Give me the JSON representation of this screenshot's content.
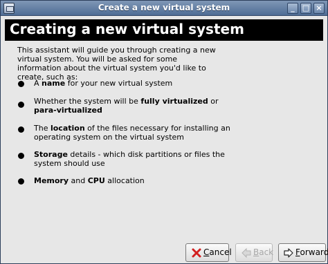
{
  "window": {
    "title": "Create a new virtual system",
    "controls": {
      "minimize": "_",
      "maximize": "□",
      "close": "×"
    }
  },
  "header": {
    "title": "Creating a new virtual system"
  },
  "intro": "This assistant will guide you through creating a new virtual system. You will be asked for some information about the virtual system you'd like to create, such as:",
  "bullets": [
    {
      "parts": [
        {
          "t": "A "
        },
        {
          "t": "name",
          "b": true
        },
        {
          "t": " for your new virtual system"
        }
      ]
    },
    {
      "parts": [
        {
          "t": "Whether the system will be "
        },
        {
          "t": "fully virtualized",
          "b": true
        },
        {
          "t": " or "
        },
        {
          "t": "para-virtualized",
          "b": true
        }
      ]
    },
    {
      "parts": [
        {
          "t": "The "
        },
        {
          "t": "location",
          "b": true
        },
        {
          "t": " of the files necessary for installing an operating system on the virtual system"
        }
      ]
    },
    {
      "parts": [
        {
          "t": "Storage",
          "b": true
        },
        {
          "t": " details - which disk partitions or files the system should use"
        }
      ]
    },
    {
      "parts": [
        {
          "t": "Memory",
          "b": true
        },
        {
          "t": " and "
        },
        {
          "t": "CPU",
          "b": true
        },
        {
          "t": " allocation"
        }
      ]
    }
  ],
  "buttons": {
    "cancel": {
      "mnemonic": "C",
      "rest": "ancel",
      "icon": "cancel-x-icon"
    },
    "back": {
      "mnemonic": "B",
      "rest": "ack",
      "icon": "back-arrow-icon",
      "disabled": true
    },
    "forward": {
      "mnemonic": "F",
      "rest": "orward",
      "icon": "forward-arrow-icon"
    }
  },
  "colors": {
    "titlebar": "#5f7ba2",
    "header_bg": "#000000",
    "window_bg": "#e7e7e7",
    "cancel_icon": "#d21f1f",
    "disabled_text": "#a7a7a7"
  }
}
